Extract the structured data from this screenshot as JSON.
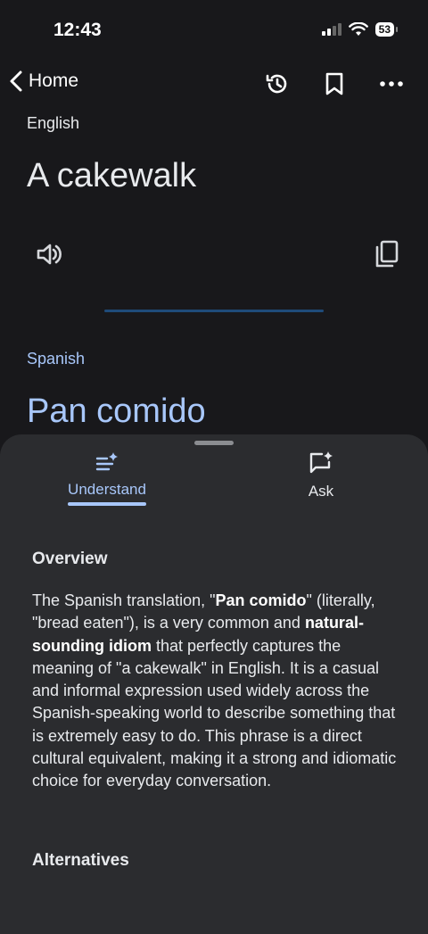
{
  "status_bar": {
    "time": "12:43",
    "battery": "53"
  },
  "topbar": {
    "back_label": "Home",
    "actions": [
      "history-icon",
      "bookmark-icon",
      "more-icon"
    ]
  },
  "source": {
    "language": "English",
    "text": "A cakewalk"
  },
  "target": {
    "language": "Spanish",
    "text": "Pan comido"
  },
  "sheet": {
    "tabs": [
      {
        "label": "Understand",
        "icon": "understand-sparkle-icon",
        "selected": true
      },
      {
        "label": "Ask",
        "icon": "ask-chat-sparkle-icon",
        "selected": false
      }
    ],
    "overview": {
      "title": "Overview",
      "t1": "The Spanish translation, \"",
      "b1": "Pan comido",
      "t2": "\" (literally, \"bread eaten\"), is a very common and ",
      "b2": "natural-sounding idiom",
      "t3": " that perfectly captures the meaning of \"a cakewalk\" in English. It is a casual and informal expression used widely across the Spanish-speaking world to describe something that is extremely easy to do. This phrase is a direct cultural equivalent, making it a strong and idiomatic choice for everyday conversation."
    },
    "alternatives": {
      "title": "Alternatives"
    }
  },
  "colors": {
    "background": "#18181b",
    "sheet": "#2b2c2f",
    "accent": "#a8c7fa"
  }
}
